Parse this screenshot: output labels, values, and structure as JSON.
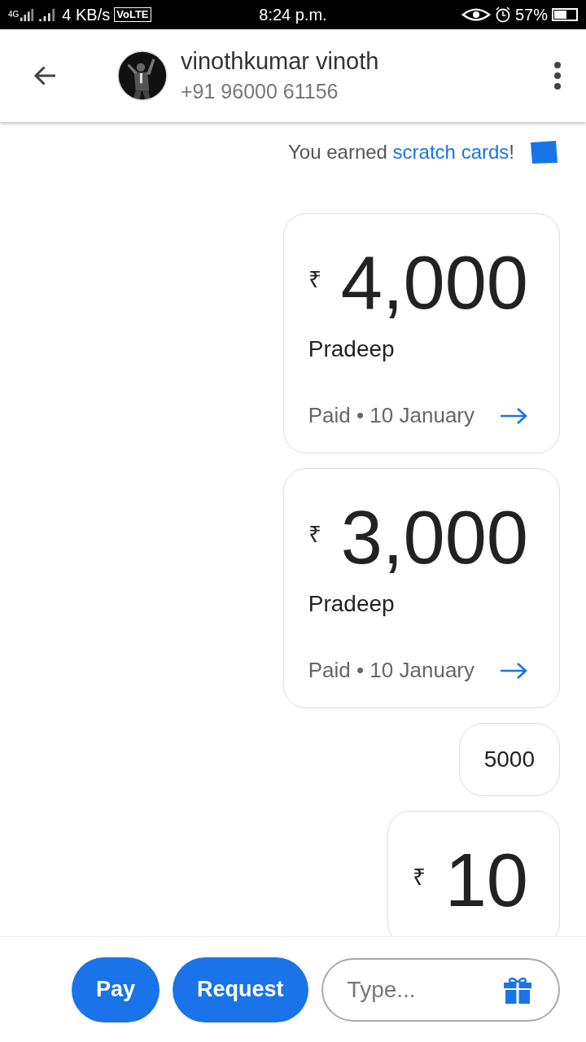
{
  "status_bar": {
    "network": "4G",
    "speed": "4 KB/s",
    "volte": "VoLTE",
    "time": "8:24 p.m.",
    "battery": "57%"
  },
  "header": {
    "name": "vinothkumar vinoth",
    "phone": "+91 96000 61156"
  },
  "notice": {
    "text": "You earned ",
    "link": "scratch cards",
    "end": "!"
  },
  "messages": [
    {
      "kind": "payment",
      "currency": "₹",
      "amount": "4,000",
      "name": "Pradeep",
      "status": "Paid • 10 January"
    },
    {
      "kind": "payment",
      "currency": "₹",
      "amount": "3,000",
      "name": "Pradeep",
      "status": "Paid • 10 January"
    },
    {
      "kind": "text",
      "text": "5000"
    },
    {
      "kind": "payment",
      "currency": "₹",
      "amount": "10"
    }
  ],
  "composer": {
    "buttons": [
      "Pay",
      "Request"
    ],
    "placeholder": "Type..."
  }
}
